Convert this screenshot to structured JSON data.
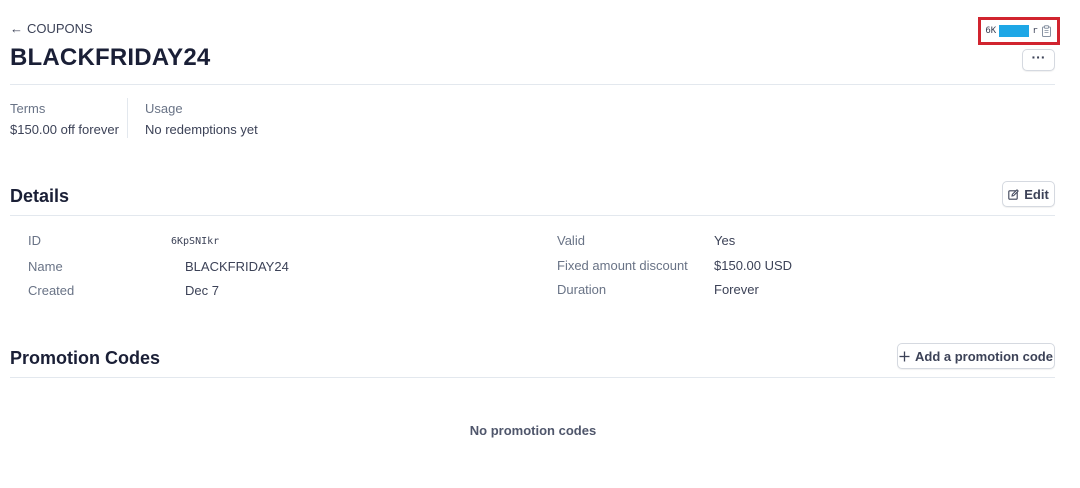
{
  "breadcrumb": {
    "arrow": "←",
    "label": "COUPONS"
  },
  "title": "BLACKFRIDAY24",
  "id_chip": {
    "prefix": "6K",
    "suffix": "r"
  },
  "more_button": {
    "label": "···"
  },
  "summary": {
    "terms_label": "Terms",
    "terms_value": "$150.00 off forever",
    "usage_label": "Usage",
    "usage_value": "No redemptions yet"
  },
  "details": {
    "title": "Details",
    "edit_label": "Edit",
    "left": [
      {
        "label": "ID",
        "value": "6KpSNIkr"
      },
      {
        "label": "Name",
        "value": "BLACKFRIDAY24"
      },
      {
        "label": "Created",
        "value": "Dec 7"
      }
    ],
    "right": [
      {
        "label": "Valid",
        "value": "Yes"
      },
      {
        "label": "Fixed amount discount",
        "value": "$150.00 USD"
      },
      {
        "label": "Duration",
        "value": "Forever"
      }
    ]
  },
  "promotion": {
    "title": "Promotion Codes",
    "add_label": "Add a promotion code",
    "empty_text": "No promotion codes"
  },
  "colors": {
    "redaction": "#1ea7e6",
    "highlight_border": "#d1242f"
  }
}
